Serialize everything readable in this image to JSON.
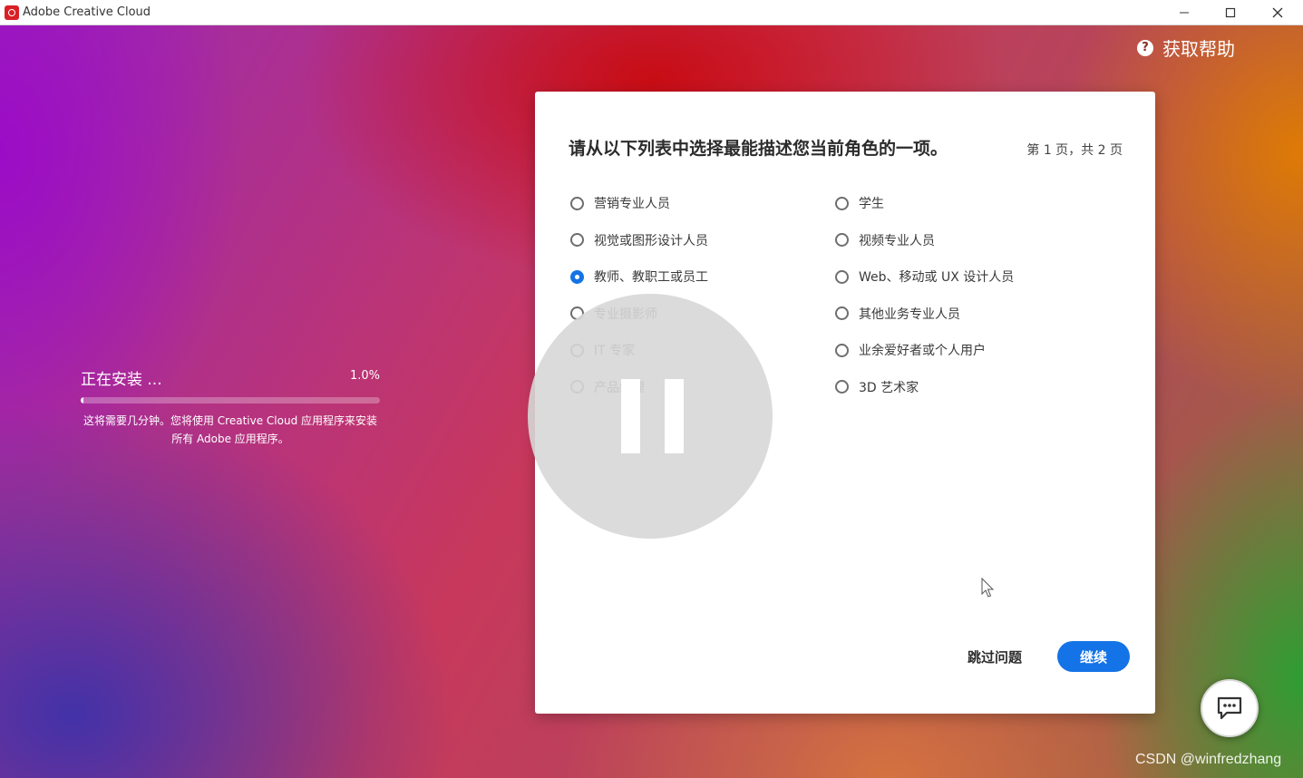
{
  "window": {
    "title": "Adobe Creative Cloud",
    "minimize_glyph": "—",
    "maximize_glyph": "☐",
    "close_glyph": "✕"
  },
  "help": {
    "icon_glyph": "?",
    "label": "获取帮助"
  },
  "install": {
    "status": "正在安装 ...",
    "percent_text": "1.0%",
    "progress_percent": 1.0,
    "note": "这将需要几分钟。您将使用 Creative Cloud 应用程序来安装所有 Adobe 应用程序。"
  },
  "dialog": {
    "question": "请从以下列表中选择最能描述您当前角色的一项。",
    "page_indicator": "第 1 页，共 2 页",
    "options_left": [
      {
        "label": "营销专业人员",
        "selected": false
      },
      {
        "label": "视觉或图形设计人员",
        "selected": false
      },
      {
        "label": "教师、教职工或员工",
        "selected": true
      },
      {
        "label": "专业摄影师",
        "selected": false
      },
      {
        "label": "IT 专家",
        "selected": false
      },
      {
        "label": "产品经理",
        "selected": false
      }
    ],
    "options_right": [
      {
        "label": "学生",
        "selected": false
      },
      {
        "label": "视频专业人员",
        "selected": false
      },
      {
        "label": "Web、移动或 UX 设计人员",
        "selected": false
      },
      {
        "label": "其他业务专业人员",
        "selected": false
      },
      {
        "label": "业余爱好者或个人用户",
        "selected": false
      },
      {
        "label": "3D 艺术家",
        "selected": false
      }
    ],
    "skip_label": "跳过问题",
    "continue_label": "继续"
  },
  "overlay": {
    "icon": "pause-icon"
  },
  "chat": {
    "icon": "chat-bubble-icon"
  },
  "watermark": "CSDN @winfredzhang",
  "colors": {
    "accent": "#1473e6",
    "adobe_red": "#da1f26"
  }
}
